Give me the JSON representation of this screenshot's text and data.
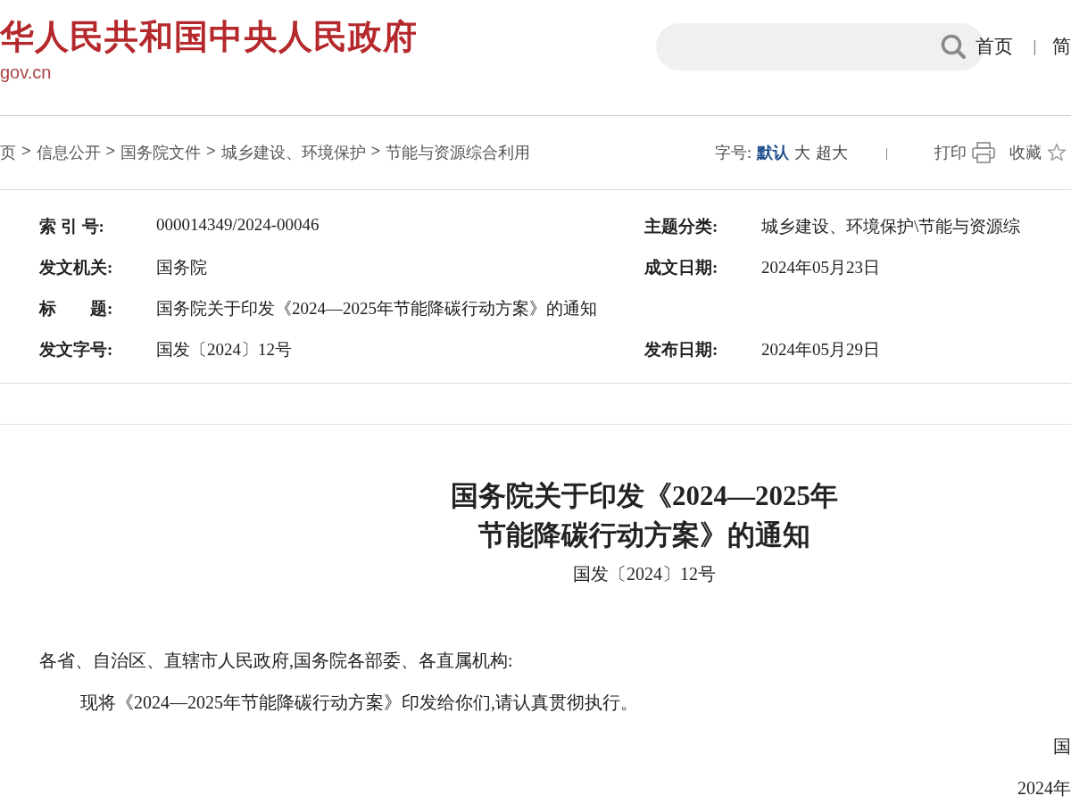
{
  "header": {
    "site_name": "华人民共和国中央人民政府",
    "domain": "gov.cn",
    "nav": [
      {
        "label": "首页"
      },
      {
        "label": "|"
      },
      {
        "label": "简"
      }
    ]
  },
  "breadcrumb": {
    "separator": ">",
    "items": [
      "页",
      "信息公开",
      "国务院文件",
      "城乡建设、环境保护",
      "节能与资源综合利用"
    ]
  },
  "tools": {
    "font_size_label": "字号:",
    "font_sizes": [
      {
        "label": "默认",
        "selected": true
      },
      {
        "label": "大",
        "selected": false
      },
      {
        "label": "超大",
        "selected": false
      }
    ],
    "divider": "|",
    "print": "打印",
    "favorite": "收藏"
  },
  "meta": [
    {
      "left": {
        "label": "索 引 号:",
        "value": "000014349/2024-00046"
      },
      "right": {
        "label": "主题分类:",
        "value": "城乡建设、环境保护\\节能与资源综"
      }
    },
    {
      "left": {
        "label": "发文机关:",
        "value": "国务院"
      },
      "right": {
        "label": "成文日期:",
        "value": "2024年05月23日"
      }
    },
    {
      "left": {
        "label": "标　　题:",
        "value": "国务院关于印发《2024—2025年节能降碳行动方案》的通知"
      }
    },
    {
      "left": {
        "label": "发文字号:",
        "value": "国发〔2024〕12号"
      },
      "right": {
        "label": "发布日期:",
        "value": "2024年05月29日"
      }
    }
  ],
  "document": {
    "title_lines": [
      "国务院关于印发《2024—2025年",
      "节能降碳行动方案》的通知"
    ],
    "doc_number": "国发〔2024〕12号",
    "salutation": "各省、自治区、直辖市人民政府,国务院各部委、各直属机构:",
    "body": "现将《2024—2025年节能降碳行动方案》印发给你们,请认真贯彻执行。",
    "signature": "国",
    "date": "2024年"
  }
}
